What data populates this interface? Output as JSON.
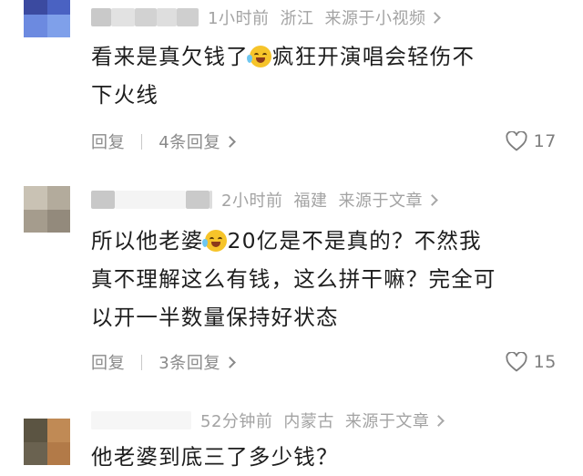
{
  "comments": [
    {
      "time": "1小时前",
      "location": "浙江",
      "source": "来源于小视频",
      "text_line1_part1": "看来是真欠钱了",
      "text_line1_part2": "疯狂开演唱会轻伤不",
      "text_line2": "下火线",
      "reply_label": "回复",
      "replies_label": "4条回复",
      "likes": "17"
    },
    {
      "time": "2小时前",
      "location": "福建",
      "source": "来源于文章",
      "text_line1_part1": "所以他老婆",
      "text_line1_part2": "20亿是不是真的？不然我",
      "text_line2": "真不理解这么有钱，这么拼干嘛？完全可",
      "text_line3": "以开一半数量保持好状态",
      "reply_label": "回复",
      "replies_label": "3条回复",
      "likes": "15"
    },
    {
      "time": "52分钟前",
      "location": "内蒙古",
      "source": "来源于文章",
      "text_line1": "他老婆到底三了多少钱？"
    }
  ],
  "icons": {
    "like": "heart-outline-icon",
    "chevron": "chevron-right-icon",
    "emoji": "crying-laughing-emoji-icon"
  },
  "colors": {
    "meta": "#a3a3a3",
    "action": "#8a8a8a",
    "text": "#1d1d1d"
  }
}
